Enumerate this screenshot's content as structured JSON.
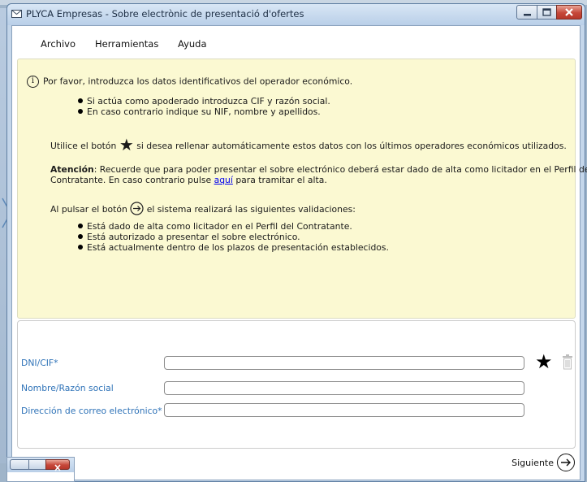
{
  "window": {
    "title": "PLYCA Empresas - Sobre electrònic de presentació d'ofertes",
    "controls": [
      "minimize",
      "maximize",
      "close"
    ]
  },
  "menu": {
    "items": [
      {
        "label": "Archivo"
      },
      {
        "label": "Herramientas"
      },
      {
        "label": "Ayuda"
      }
    ]
  },
  "info": {
    "intro_icon": "info-i",
    "intro": "Por favor, introduzca los datos identificativos del operador económico.",
    "bullets1": [
      "Si actúa como apoderado introduzca CIF y razón social.",
      "En caso contrario indique su NIF, nombre y apellidos."
    ],
    "star_prefix": "Utilice el botón",
    "star_suffix": "si desea rellenar automáticamente estos datos con los últimos operadores económicos utilizados.",
    "attention_label": "Atención",
    "attention_text1": ": Recuerde que para poder presentar el sobre electrónico deberá estar dado de alta como licitador en el Perfil del",
    "attention_text2_prefix": "Contratante. En caso contrario pulse",
    "attention_link": "aquí",
    "attention_text2_suffix": "para tramitar el alta.",
    "arrow_prefix": "Al pulsar el botón",
    "arrow_suffix": "el sistema realizará las siguientes validaciones:",
    "bullets2": [
      "Está dado de alta como licitador en el Perfil del Contratante.",
      "Está autorizado a presentar el sobre electrónico.",
      "Está actualmente dentro de los plazos de presentación establecidos."
    ]
  },
  "form": {
    "fields": [
      {
        "label": "DNI/CIF*",
        "value": ""
      },
      {
        "label": "Nombre/Razón social",
        "value": ""
      },
      {
        "label": "Dirección de correo electrónico*",
        "value": ""
      }
    ],
    "icons": [
      "star-icon",
      "trash-icon"
    ]
  },
  "footer": {
    "next_label": "Siguiente"
  },
  "colors": {
    "info_bg": "#fbf9d2",
    "label_blue": "#2f73b8",
    "link_blue": "#0000ee",
    "close_red": "#c6483a"
  }
}
